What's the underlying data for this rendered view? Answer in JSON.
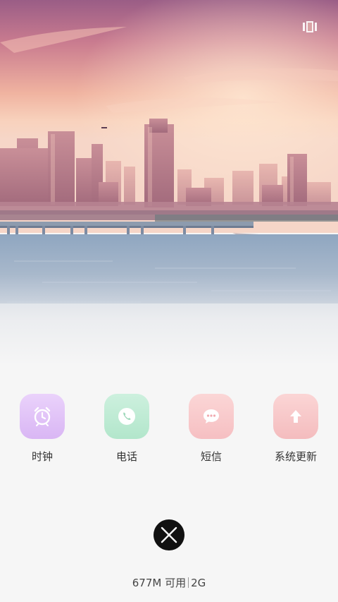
{
  "wallpaper": {
    "description_icon": "city-skyline-wallpaper"
  },
  "recents": {
    "icon": "recents-grid-icon"
  },
  "apps": [
    {
      "label": "时钟",
      "icon": "alarm-clock-icon",
      "color": "#d9b6f4"
    },
    {
      "label": "电话",
      "icon": "phone-icon",
      "color": "#b2e6cb"
    },
    {
      "label": "短信",
      "icon": "message-bubble-icon",
      "color": "#f6bfc2"
    },
    {
      "label": "系统更新",
      "icon": "arrow-up-icon",
      "color": "#f4bcbe"
    }
  ],
  "close": {
    "icon": "close-icon"
  },
  "memory": {
    "available": "677M 可用",
    "total": "2G"
  }
}
